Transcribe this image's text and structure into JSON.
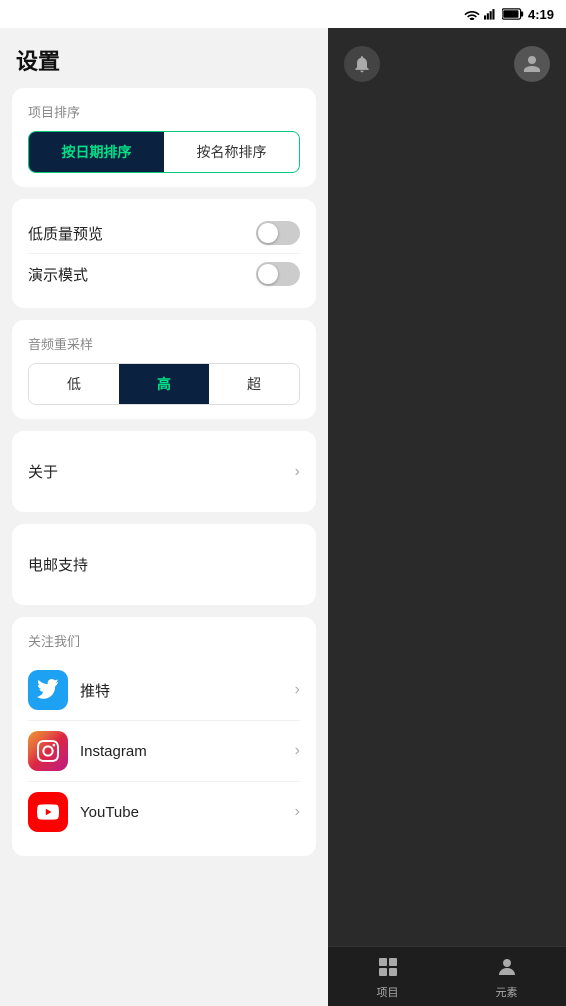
{
  "statusBar": {
    "time": "4:19"
  },
  "settings": {
    "title": "设置",
    "sortSection": {
      "label": "项目排序",
      "btn1": "按日期排序",
      "btn2": "按名称排序",
      "activeBtn": 0
    },
    "toggleSection": {
      "lowQuality": {
        "label": "低质量预览",
        "enabled": false
      },
      "demoMode": {
        "label": "演示模式",
        "enabled": false
      }
    },
    "audioSection": {
      "label": "音频重采样",
      "options": [
        "低",
        "高",
        "超"
      ],
      "activeIndex": 1
    },
    "about": {
      "label": "关于"
    },
    "emailSupport": {
      "label": "电邮支持"
    },
    "followUs": {
      "label": "关注我们",
      "items": [
        {
          "name": "推特",
          "icon": "twitter"
        },
        {
          "name": "Instagram",
          "icon": "instagram"
        },
        {
          "name": "YouTube",
          "icon": "youtube"
        }
      ]
    }
  },
  "bottomNav": {
    "items": [
      {
        "label": "项目",
        "icon": "grid"
      },
      {
        "label": "元素",
        "icon": "person"
      }
    ]
  }
}
